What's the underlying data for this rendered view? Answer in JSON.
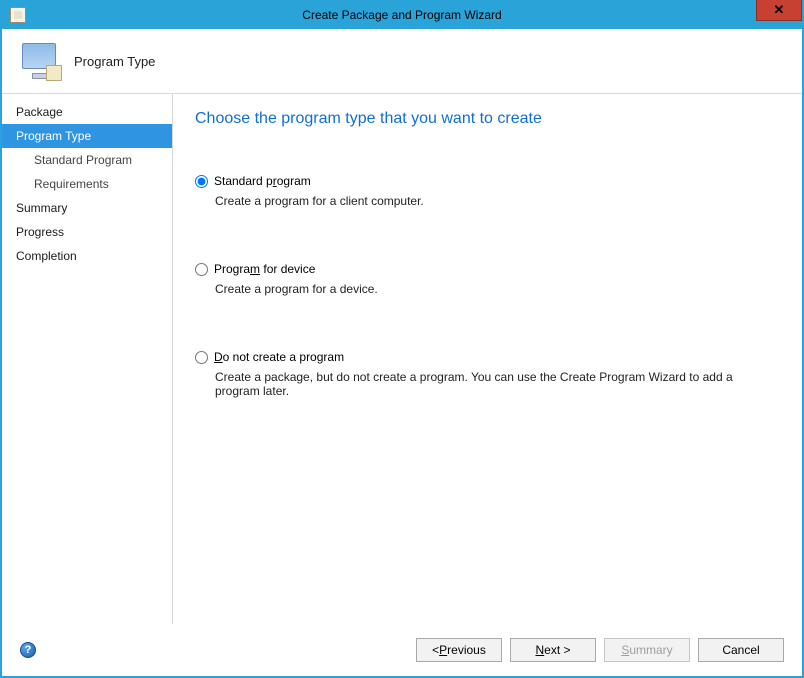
{
  "window": {
    "title": "Create Package and Program Wizard"
  },
  "header": {
    "title": "Program Type"
  },
  "sidebar": {
    "items": [
      {
        "label": "Package",
        "active": false,
        "sub": false
      },
      {
        "label": "Program Type",
        "active": true,
        "sub": false
      },
      {
        "label": "Standard Program",
        "active": false,
        "sub": true
      },
      {
        "label": "Requirements",
        "active": false,
        "sub": true
      },
      {
        "label": "Summary",
        "active": false,
        "sub": false
      },
      {
        "label": "Progress",
        "active": false,
        "sub": false
      },
      {
        "label": "Completion",
        "active": false,
        "sub": false
      }
    ]
  },
  "content": {
    "instruction": "Choose the program type that you want to create",
    "options": [
      {
        "label_pre": "Standard p",
        "label_u": "r",
        "label_post": "ogram",
        "checked": true,
        "description": "Create a program for a client computer."
      },
      {
        "label_pre": "Progra",
        "label_u": "m",
        "label_post": " for device",
        "checked": false,
        "description": "Create a program for a device."
      },
      {
        "label_pre": "",
        "label_u": "D",
        "label_post": "o not create a program",
        "checked": false,
        "description": "Create a package, but do not create a program. You can use the Create Program Wizard to add a program later."
      }
    ]
  },
  "footer": {
    "help": "?",
    "buttons": {
      "previous_pre": "< ",
      "previous_u": "P",
      "previous_post": "revious",
      "next_pre": "",
      "next_u": "N",
      "next_post": "ext >",
      "summary_pre": "",
      "summary_u": "S",
      "summary_post": "ummary",
      "cancel": "Cancel"
    }
  }
}
